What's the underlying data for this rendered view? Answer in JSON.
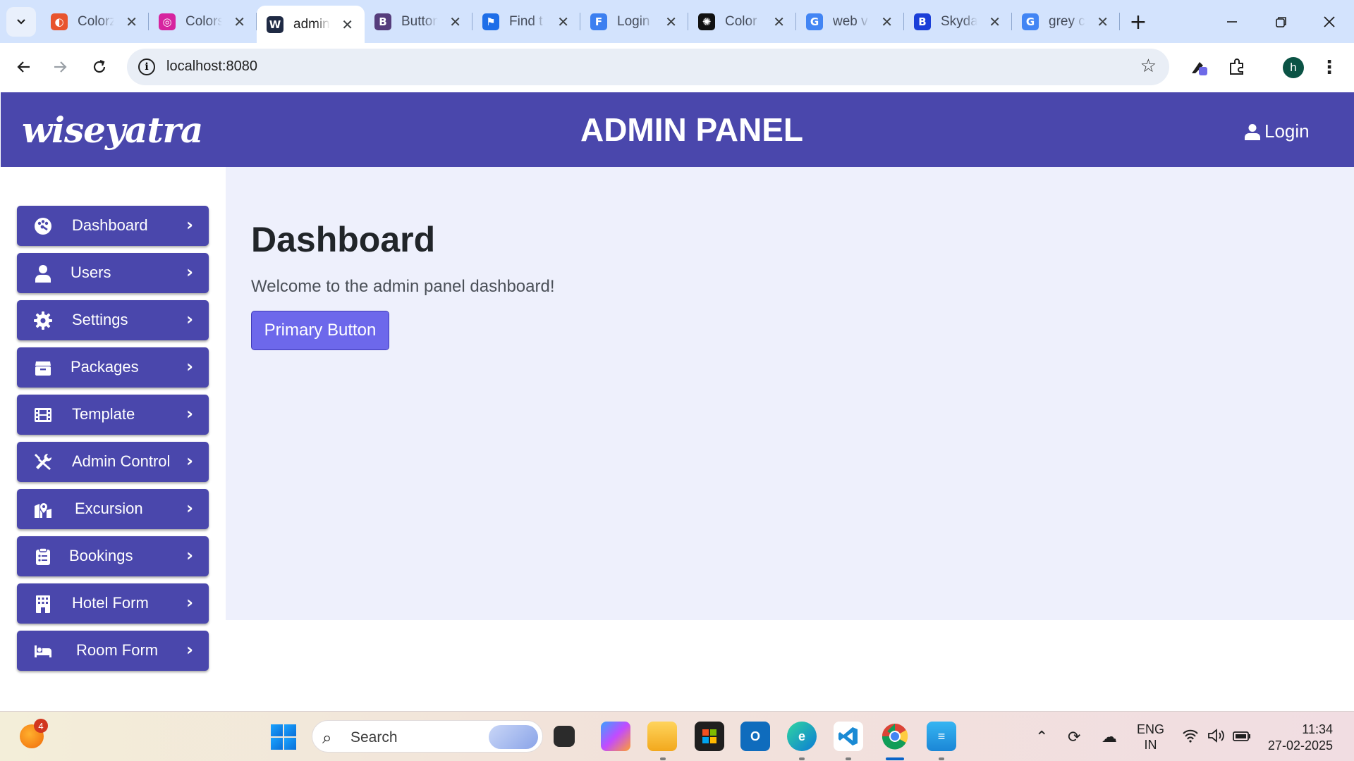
{
  "browser": {
    "tabs": [
      {
        "label": "Colorz",
        "icon": "colorz-favicon",
        "color": "#e8542e"
      },
      {
        "label": "Colors",
        "icon": "instagram-favicon",
        "color": "#d6249f"
      },
      {
        "label": "admin",
        "icon": "wiseyatra-favicon",
        "color": "#1f2a44",
        "active": true
      },
      {
        "label": "Button",
        "icon": "bootstrap-favicon",
        "color": "#563d7c"
      },
      {
        "label": "Find t",
        "icon": "flag-favicon",
        "color": "#1e6ee8"
      },
      {
        "label": "Login",
        "icon": "forms-favicon",
        "color": "#3c7ff0"
      },
      {
        "label": "Color",
        "icon": "openai-favicon",
        "color": "#111111"
      },
      {
        "label": "web v",
        "icon": "google-favicon",
        "color": "#4285f4"
      },
      {
        "label": "Skyda",
        "icon": "bold-b-favicon",
        "color": "#1b3fd8"
      },
      {
        "label": "grey c",
        "icon": "google-favicon",
        "color": "#4285f4"
      }
    ],
    "url": "localhost:8080",
    "profile_initial": "h"
  },
  "header": {
    "logo_text": "wiseyatra",
    "title": "ADMIN PANEL",
    "login_label": "Login"
  },
  "sidebar": {
    "items": [
      {
        "label": "Dashboard",
        "icon": "palette-icon"
      },
      {
        "label": "Users",
        "icon": "user-icon"
      },
      {
        "label": "Settings",
        "icon": "gear-icon"
      },
      {
        "label": "Packages",
        "icon": "box-icon"
      },
      {
        "label": "Template",
        "icon": "film-icon"
      },
      {
        "label": "Admin Control",
        "icon": "tools-icon"
      },
      {
        "label": "Excursion",
        "icon": "map-location-icon"
      },
      {
        "label": "Bookings",
        "icon": "clipboard-icon"
      },
      {
        "label": "Hotel Form",
        "icon": "building-icon"
      },
      {
        "label": "Room Form",
        "icon": "bed-icon"
      }
    ]
  },
  "main": {
    "heading": "Dashboard",
    "welcome": "Welcome to the admin panel dashboard!",
    "primary_button": "Primary Button"
  },
  "taskbar": {
    "weather_badge": "4",
    "search_placeholder": "Search",
    "lang_line1": "ENG",
    "lang_line2": "IN",
    "time": "11:34",
    "date": "27-02-2025"
  },
  "colors": {
    "brand": "#4a47ac",
    "button": "#6d68eb",
    "main_bg": "#eef0fc"
  }
}
